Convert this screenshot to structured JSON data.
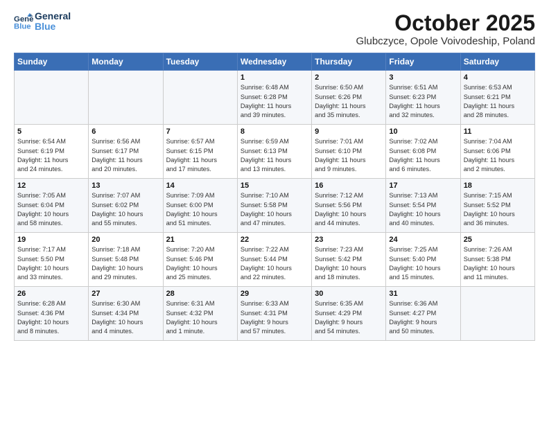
{
  "header": {
    "logo_line1": "General",
    "logo_line2": "Blue",
    "title": "October 2025",
    "subtitle": "Glubczyce, Opole Voivodeship, Poland"
  },
  "days_of_week": [
    "Sunday",
    "Monday",
    "Tuesday",
    "Wednesday",
    "Thursday",
    "Friday",
    "Saturday"
  ],
  "weeks": [
    [
      {
        "day": "",
        "info": ""
      },
      {
        "day": "",
        "info": ""
      },
      {
        "day": "",
        "info": ""
      },
      {
        "day": "1",
        "info": "Sunrise: 6:48 AM\nSunset: 6:28 PM\nDaylight: 11 hours\nand 39 minutes."
      },
      {
        "day": "2",
        "info": "Sunrise: 6:50 AM\nSunset: 6:26 PM\nDaylight: 11 hours\nand 35 minutes."
      },
      {
        "day": "3",
        "info": "Sunrise: 6:51 AM\nSunset: 6:23 PM\nDaylight: 11 hours\nand 32 minutes."
      },
      {
        "day": "4",
        "info": "Sunrise: 6:53 AM\nSunset: 6:21 PM\nDaylight: 11 hours\nand 28 minutes."
      }
    ],
    [
      {
        "day": "5",
        "info": "Sunrise: 6:54 AM\nSunset: 6:19 PM\nDaylight: 11 hours\nand 24 minutes."
      },
      {
        "day": "6",
        "info": "Sunrise: 6:56 AM\nSunset: 6:17 PM\nDaylight: 11 hours\nand 20 minutes."
      },
      {
        "day": "7",
        "info": "Sunrise: 6:57 AM\nSunset: 6:15 PM\nDaylight: 11 hours\nand 17 minutes."
      },
      {
        "day": "8",
        "info": "Sunrise: 6:59 AM\nSunset: 6:13 PM\nDaylight: 11 hours\nand 13 minutes."
      },
      {
        "day": "9",
        "info": "Sunrise: 7:01 AM\nSunset: 6:10 PM\nDaylight: 11 hours\nand 9 minutes."
      },
      {
        "day": "10",
        "info": "Sunrise: 7:02 AM\nSunset: 6:08 PM\nDaylight: 11 hours\nand 6 minutes."
      },
      {
        "day": "11",
        "info": "Sunrise: 7:04 AM\nSunset: 6:06 PM\nDaylight: 11 hours\nand 2 minutes."
      }
    ],
    [
      {
        "day": "12",
        "info": "Sunrise: 7:05 AM\nSunset: 6:04 PM\nDaylight: 10 hours\nand 58 minutes."
      },
      {
        "day": "13",
        "info": "Sunrise: 7:07 AM\nSunset: 6:02 PM\nDaylight: 10 hours\nand 55 minutes."
      },
      {
        "day": "14",
        "info": "Sunrise: 7:09 AM\nSunset: 6:00 PM\nDaylight: 10 hours\nand 51 minutes."
      },
      {
        "day": "15",
        "info": "Sunrise: 7:10 AM\nSunset: 5:58 PM\nDaylight: 10 hours\nand 47 minutes."
      },
      {
        "day": "16",
        "info": "Sunrise: 7:12 AM\nSunset: 5:56 PM\nDaylight: 10 hours\nand 44 minutes."
      },
      {
        "day": "17",
        "info": "Sunrise: 7:13 AM\nSunset: 5:54 PM\nDaylight: 10 hours\nand 40 minutes."
      },
      {
        "day": "18",
        "info": "Sunrise: 7:15 AM\nSunset: 5:52 PM\nDaylight: 10 hours\nand 36 minutes."
      }
    ],
    [
      {
        "day": "19",
        "info": "Sunrise: 7:17 AM\nSunset: 5:50 PM\nDaylight: 10 hours\nand 33 minutes."
      },
      {
        "day": "20",
        "info": "Sunrise: 7:18 AM\nSunset: 5:48 PM\nDaylight: 10 hours\nand 29 minutes."
      },
      {
        "day": "21",
        "info": "Sunrise: 7:20 AM\nSunset: 5:46 PM\nDaylight: 10 hours\nand 25 minutes."
      },
      {
        "day": "22",
        "info": "Sunrise: 7:22 AM\nSunset: 5:44 PM\nDaylight: 10 hours\nand 22 minutes."
      },
      {
        "day": "23",
        "info": "Sunrise: 7:23 AM\nSunset: 5:42 PM\nDaylight: 10 hours\nand 18 minutes."
      },
      {
        "day": "24",
        "info": "Sunrise: 7:25 AM\nSunset: 5:40 PM\nDaylight: 10 hours\nand 15 minutes."
      },
      {
        "day": "25",
        "info": "Sunrise: 7:26 AM\nSunset: 5:38 PM\nDaylight: 10 hours\nand 11 minutes."
      }
    ],
    [
      {
        "day": "26",
        "info": "Sunrise: 6:28 AM\nSunset: 4:36 PM\nDaylight: 10 hours\nand 8 minutes."
      },
      {
        "day": "27",
        "info": "Sunrise: 6:30 AM\nSunset: 4:34 PM\nDaylight: 10 hours\nand 4 minutes."
      },
      {
        "day": "28",
        "info": "Sunrise: 6:31 AM\nSunset: 4:32 PM\nDaylight: 10 hours\nand 1 minute."
      },
      {
        "day": "29",
        "info": "Sunrise: 6:33 AM\nSunset: 4:31 PM\nDaylight: 9 hours\nand 57 minutes."
      },
      {
        "day": "30",
        "info": "Sunrise: 6:35 AM\nSunset: 4:29 PM\nDaylight: 9 hours\nand 54 minutes."
      },
      {
        "day": "31",
        "info": "Sunrise: 6:36 AM\nSunset: 4:27 PM\nDaylight: 9 hours\nand 50 minutes."
      },
      {
        "day": "",
        "info": ""
      }
    ]
  ]
}
